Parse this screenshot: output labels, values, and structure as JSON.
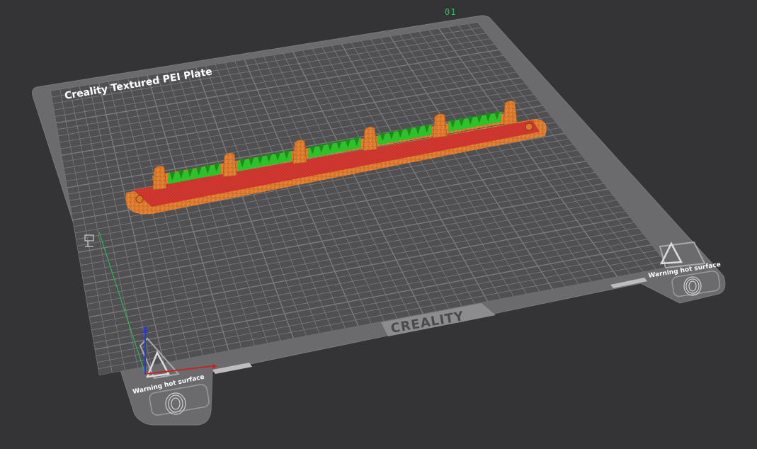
{
  "plate": {
    "number": "01",
    "name": "Creality Textured PEI Plate",
    "brand_logo": "CREALITY",
    "warning_label": "Warning hot surface",
    "warning_icon": "hot-surface-warning-icon",
    "fingerprint_icon": "fingerprint-icon"
  },
  "colors": {
    "background": "#343436",
    "plate_outer": "#6b6b6d",
    "plate_inner": "#505052",
    "grid_line": "#8a8a8c",
    "model_orange": "#d9782c",
    "model_red": "#c8322a",
    "model_green": "#2ec22a",
    "axis_x": "#c0262a",
    "axis_y": "#2eb552",
    "axis_z": "#2a3ad0",
    "plate_number": "#22c55e"
  },
  "model": {
    "description_icon": "sliced-model-preview",
    "posts": 6,
    "green_segments": 6
  }
}
